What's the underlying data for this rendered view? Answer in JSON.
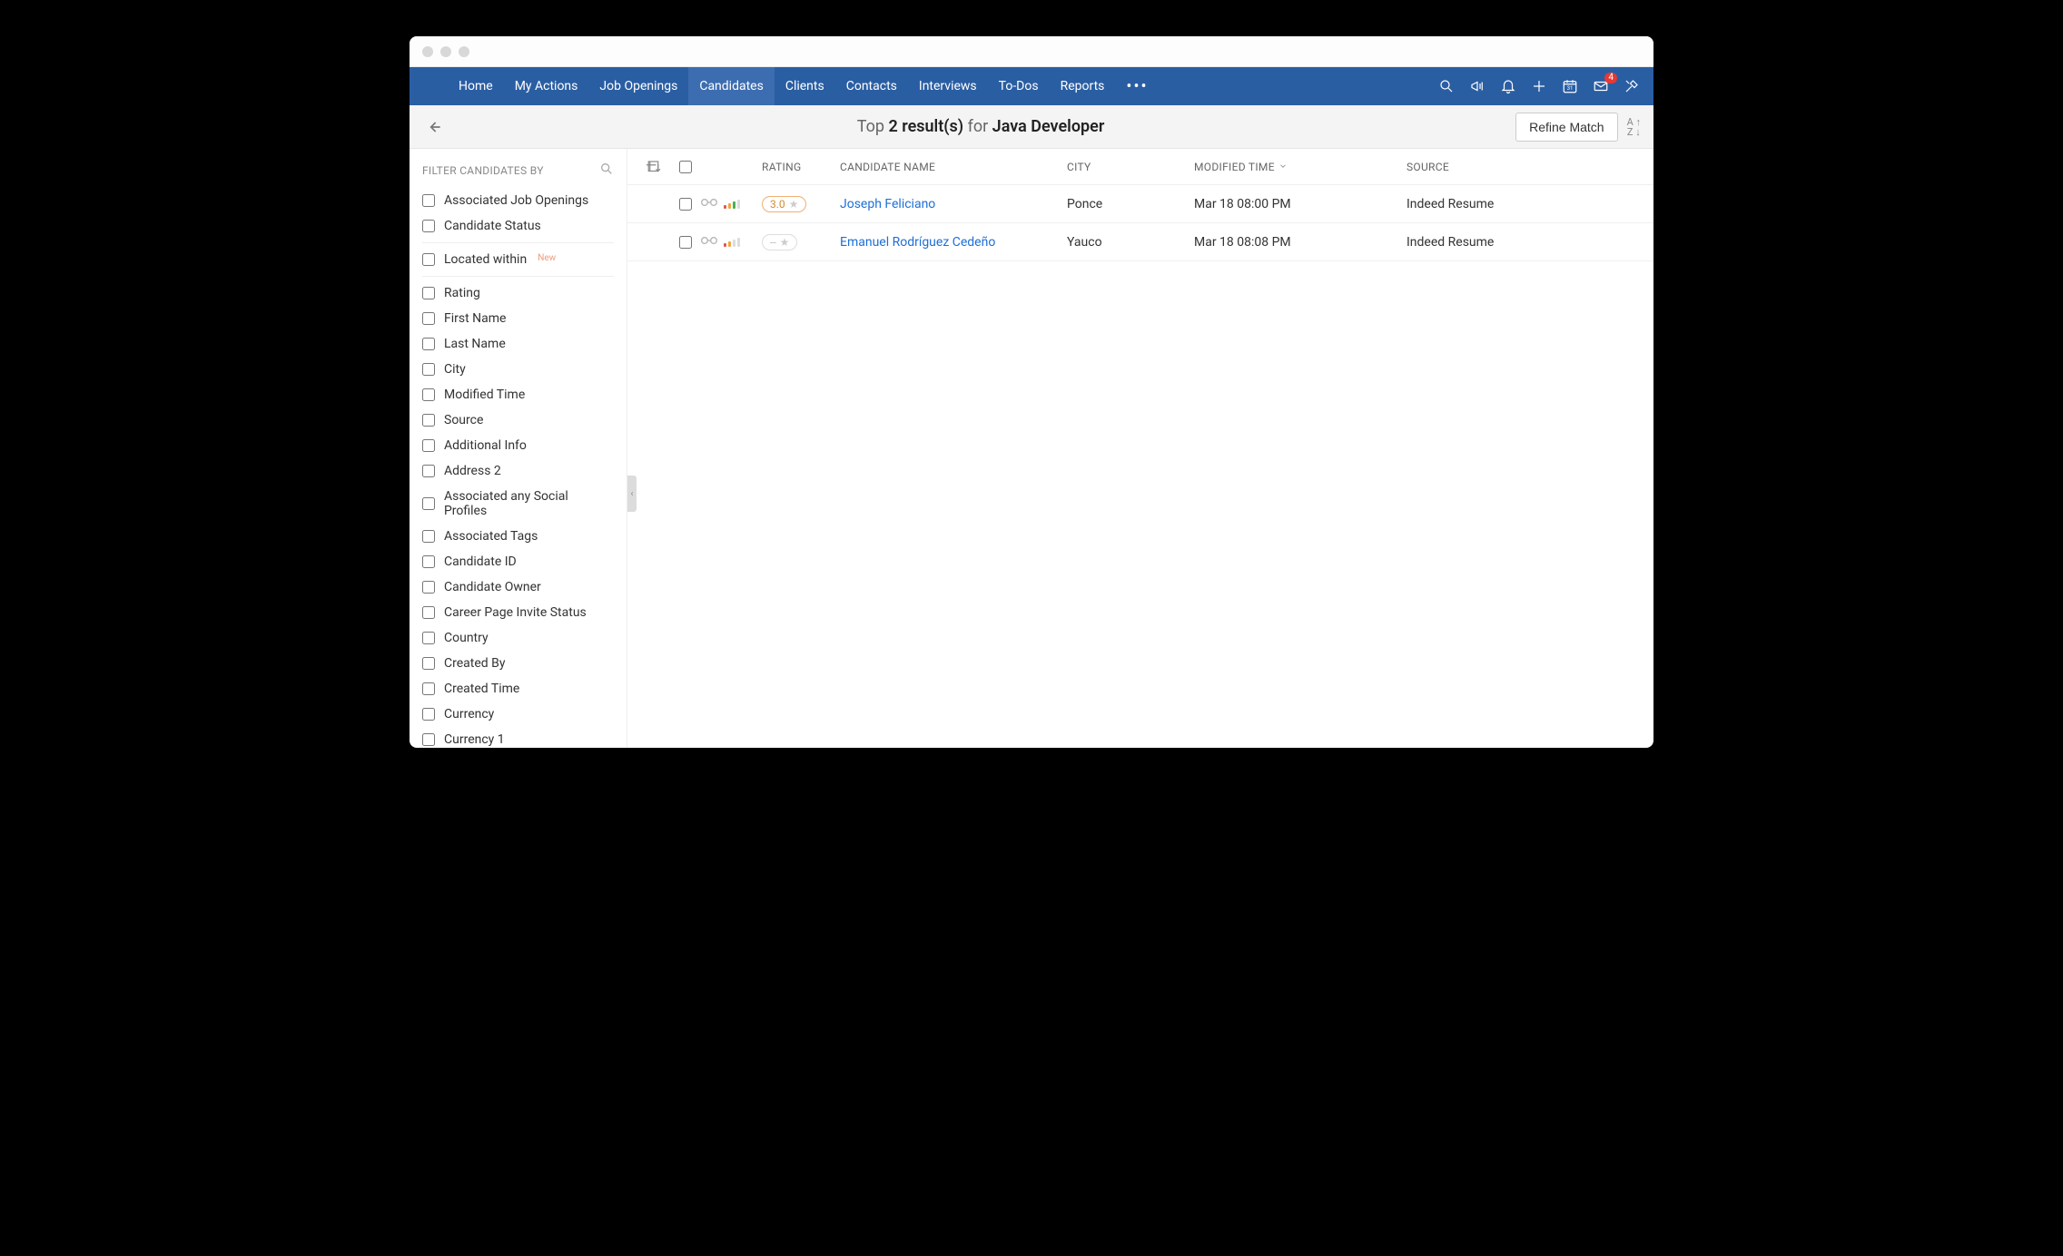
{
  "nav": {
    "items": [
      "Home",
      "My Actions",
      "Job Openings",
      "Candidates",
      "Clients",
      "Contacts",
      "Interviews",
      "To-Dos",
      "Reports"
    ],
    "activeIndex": 3,
    "mailBadge": "4"
  },
  "subheader": {
    "prefix": "Top",
    "count": "2 result(s)",
    "for": "for",
    "query": "Java Developer",
    "refineLabel": "Refine Match"
  },
  "sidebar": {
    "title": "FILTER CANDIDATES BY",
    "group1": [
      "Associated Job Openings",
      "Candidate Status"
    ],
    "locatedWithin": "Located within",
    "newTag": "New",
    "group2": [
      "Rating",
      "First Name",
      "Last Name",
      "City",
      "Modified Time",
      "Source",
      "Additional Info",
      "Address 2",
      "Associated any Social Profiles",
      "Associated Tags",
      "Candidate ID",
      "Candidate Owner",
      "Career Page Invite Status",
      "Country",
      "Created By",
      "Created Time",
      "Currency",
      "Currency 1"
    ]
  },
  "table": {
    "headers": {
      "rating": "RATING",
      "name": "CANDIDATE NAME",
      "city": "CITY",
      "mtime": "MODIFIED TIME",
      "source": "SOURCE"
    },
    "rows": [
      {
        "rating": "3.0",
        "name": "Joseph Feliciano",
        "city": "Ponce",
        "mtime": "Mar 18 08:00 PM",
        "source": "Indeed Resume",
        "signal": "hi"
      },
      {
        "rating": "--",
        "name": "Emanuel Rodríguez Cedeño",
        "city": "Yauco",
        "mtime": "Mar 18 08:08 PM",
        "source": "Indeed Resume",
        "signal": "lo"
      }
    ]
  }
}
